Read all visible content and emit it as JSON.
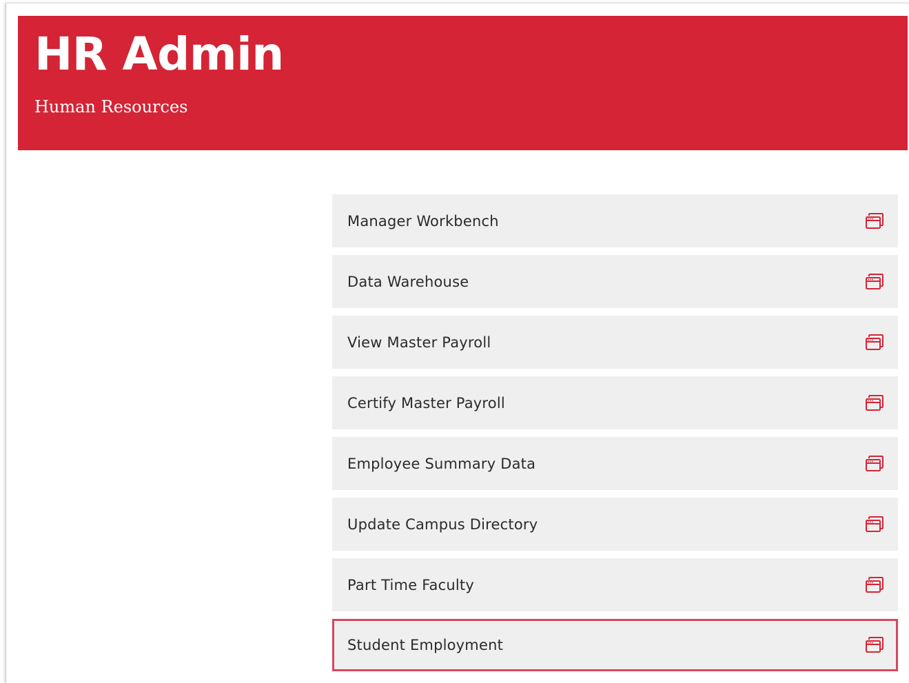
{
  "header": {
    "title": "HR Admin",
    "subtitle": "Human Resources"
  },
  "theme": {
    "brand_red": "#d42436",
    "item_bg": "#efefef",
    "active_border": "#d5485e"
  },
  "links": [
    {
      "label": "Manager Workbench",
      "icon": "external-window-icon",
      "active": false
    },
    {
      "label": "Data Warehouse",
      "icon": "external-window-icon",
      "active": false
    },
    {
      "label": "View Master Payroll",
      "icon": "external-window-icon",
      "active": false
    },
    {
      "label": "Certify Master Payroll",
      "icon": "external-window-icon",
      "active": false
    },
    {
      "label": "Employee Summary Data",
      "icon": "external-window-icon",
      "active": false
    },
    {
      "label": "Update Campus Directory",
      "icon": "external-window-icon",
      "active": false
    },
    {
      "label": "Part Time Faculty",
      "icon": "external-window-icon",
      "active": false
    },
    {
      "label": "Student Employment",
      "icon": "external-window-icon",
      "active": true
    }
  ]
}
